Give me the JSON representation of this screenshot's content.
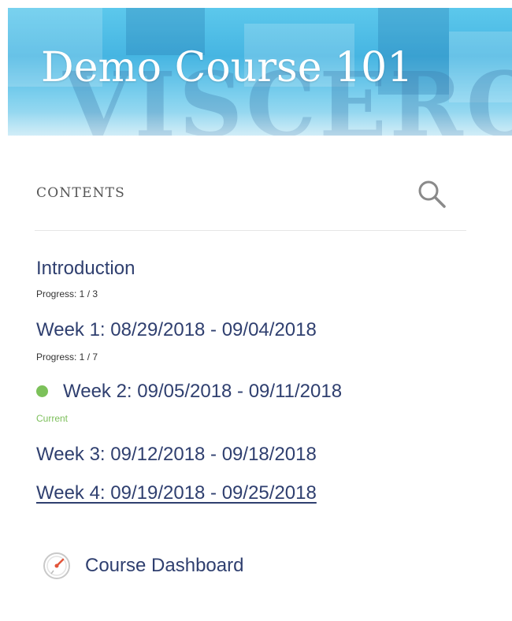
{
  "banner": {
    "title": "Demo Course 101",
    "watermark": "VISCERO"
  },
  "contents": {
    "label": "CONTENTS",
    "search_icon": "search-icon"
  },
  "items": [
    {
      "title": "Introduction",
      "sub": "Progress: 1 / 3"
    },
    {
      "title": "Week 1: 08/29/2018 - 09/04/2018",
      "sub": "Progress: 1 / 7"
    },
    {
      "title": "Week 2: 09/05/2018 - 09/11/2018",
      "sub": "Current",
      "status_color": "#7cc15a"
    },
    {
      "title": "Week 3: 09/12/2018 - 09/18/2018"
    },
    {
      "title": "Week 4: 09/19/2018 - 09/25/2018"
    }
  ],
  "dashboard": {
    "label": "Course Dashboard",
    "icon": "dashboard-gauge-icon"
  },
  "colors": {
    "link": "#2f3f6f",
    "current": "#7cc15a",
    "banner": "#46b5e2"
  }
}
